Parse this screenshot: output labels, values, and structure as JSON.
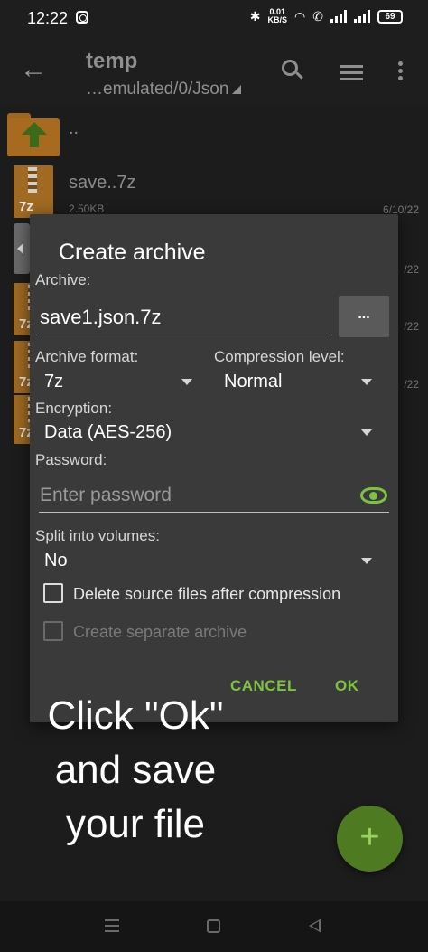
{
  "status_bar": {
    "time": "12:22",
    "net_speed_value": "0.01",
    "net_speed_unit": "KB/S",
    "battery": "69"
  },
  "toolbar": {
    "title": "temp",
    "path": "…emulated/0/Json"
  },
  "files": {
    "parent_label": "..",
    "items": [
      {
        "name": "save..7z",
        "size": "2.50KB",
        "date": "6/10/22",
        "icon_tag": "7z"
      },
      {
        "date": "/22",
        "icon_tag": "7z"
      },
      {
        "date": "/22",
        "icon_tag": "7z"
      },
      {
        "date": "/22",
        "icon_tag": "7z"
      }
    ]
  },
  "dialog": {
    "title": "Create archive",
    "archive_label": "Archive:",
    "archive_value": "save1.json.7z",
    "browse_label": "...",
    "format_label": "Archive format:",
    "format_value": "7z",
    "compression_label": "Compression level:",
    "compression_value": "Normal",
    "encryption_label": "Encryption:",
    "encryption_value": "Data (AES-256)",
    "password_label": "Password:",
    "password_placeholder": "Enter password",
    "split_label": "Split into volumes:",
    "split_value": "No",
    "delete_source_label": "Delete source files after compression",
    "separate_archive_label": "Create separate archive",
    "cancel_label": "CANCEL",
    "ok_label": "OK"
  },
  "caption": {
    "line1": "Click \"Ok\"",
    "line2": "and save",
    "line3": "your file"
  },
  "fab": {
    "label": "+"
  },
  "colors": {
    "accent": "#7ec242",
    "dialog_bg": "#3a3a3a",
    "fab_bg": "#4e7a22",
    "background": "#1c1c1c"
  },
  "icons": [
    "back-arrow-icon",
    "search-icon",
    "list-view-icon",
    "more-vert-icon",
    "folder-up-icon",
    "7z-file-icon",
    "eye-icon",
    "plus-icon",
    "nav-menu-icon",
    "nav-home-icon",
    "nav-back-icon"
  ]
}
